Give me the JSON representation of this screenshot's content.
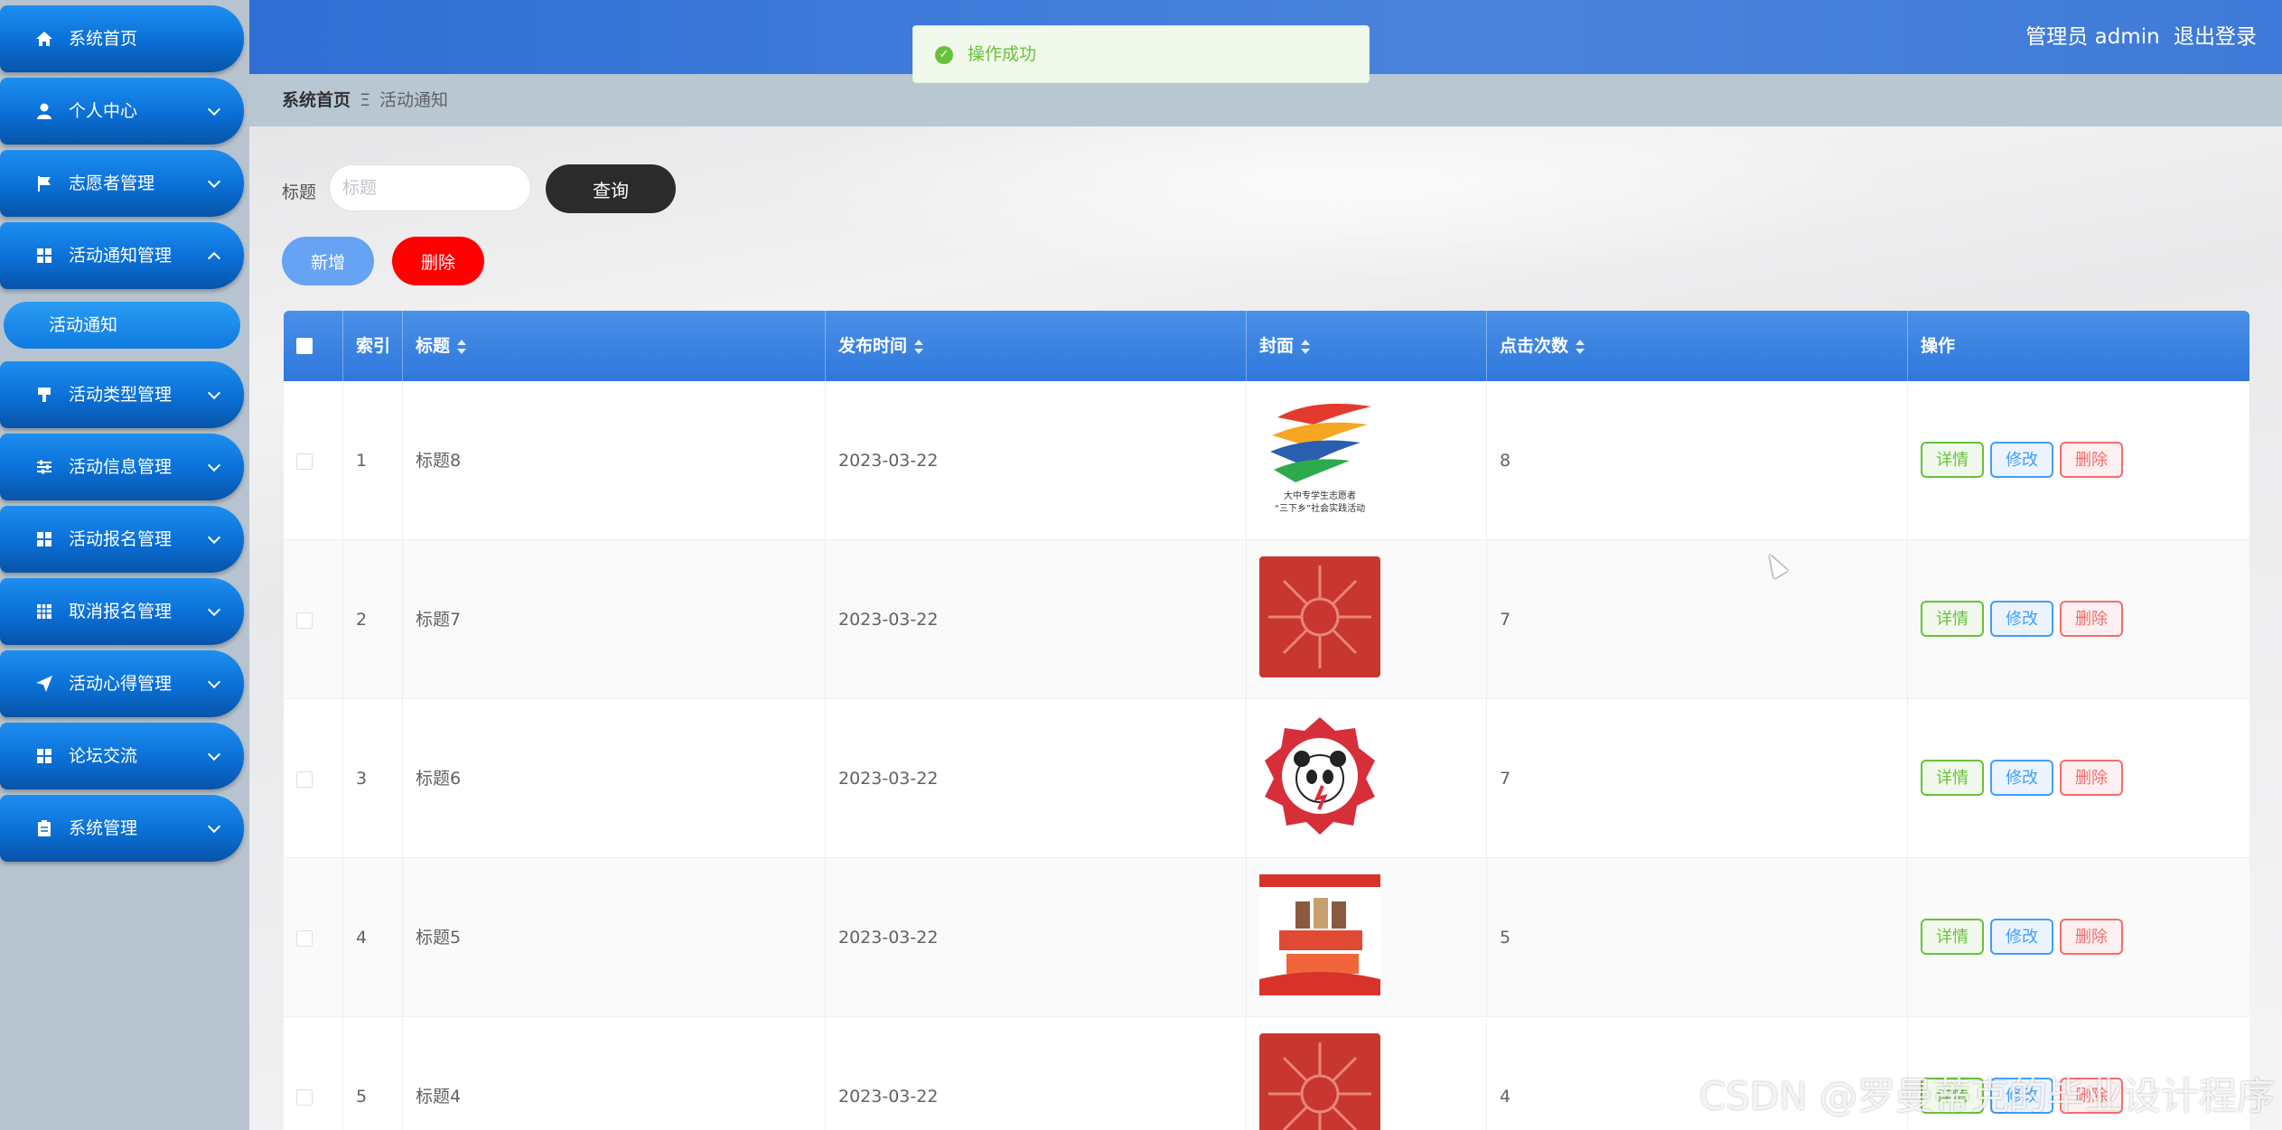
{
  "sidebar": {
    "items": [
      {
        "label": "系统首页",
        "icon": "home-icon"
      },
      {
        "label": "个人中心",
        "icon": "user-icon"
      },
      {
        "label": "志愿者管理",
        "icon": "flag-icon"
      },
      {
        "label": "活动通知管理",
        "icon": "grid-icon"
      },
      {
        "label": "活动类型管理",
        "icon": "brush-icon"
      },
      {
        "label": "活动信息管理",
        "icon": "sliders-icon"
      },
      {
        "label": "活动报名管理",
        "icon": "grid-icon"
      },
      {
        "label": "取消报名管理",
        "icon": "table-icon"
      },
      {
        "label": "活动心得管理",
        "icon": "send-icon"
      },
      {
        "label": "论坛交流",
        "icon": "grid-icon"
      },
      {
        "label": "系统管理",
        "icon": "clipboard-icon"
      }
    ],
    "submenu_active": "活动通知"
  },
  "header": {
    "user_text": "管理员 admin",
    "logout": "退出登录"
  },
  "toast": {
    "message": "操作成功"
  },
  "breadcrumb": {
    "home": "系统首页",
    "current": "活动通知"
  },
  "search": {
    "label": "标题",
    "placeholder": "标题",
    "button": "查询"
  },
  "actions": {
    "add": "新增",
    "delete": "删除"
  },
  "table": {
    "columns": [
      "索引",
      "标题",
      "发布时间",
      "封面",
      "点击次数",
      "操作"
    ],
    "rows": [
      {
        "index": "1",
        "title": "标题8",
        "date": "2023-03-22",
        "clicks": "8",
        "cover": "volunteer-logo"
      },
      {
        "index": "2",
        "title": "标题7",
        "date": "2023-03-22",
        "clicks": "7",
        "cover": "red-hands"
      },
      {
        "index": "3",
        "title": "标题6",
        "date": "2023-03-22",
        "clicks": "7",
        "cover": "panda-badge"
      },
      {
        "index": "4",
        "title": "标题5",
        "date": "2023-03-22",
        "clicks": "5",
        "cover": "poster"
      },
      {
        "index": "5",
        "title": "标题4",
        "date": "2023-03-22",
        "clicks": "4",
        "cover": "red-hands"
      }
    ],
    "op_labels": {
      "detail": "详情",
      "edit": "修改",
      "delete": "删除"
    }
  },
  "cover_text": {
    "logo_line1": "大中专学生志愿者",
    "logo_line2": "“三下乡”社会实践活动"
  },
  "watermark": "CSDN @罗曼蒂克的毕业设计程序"
}
